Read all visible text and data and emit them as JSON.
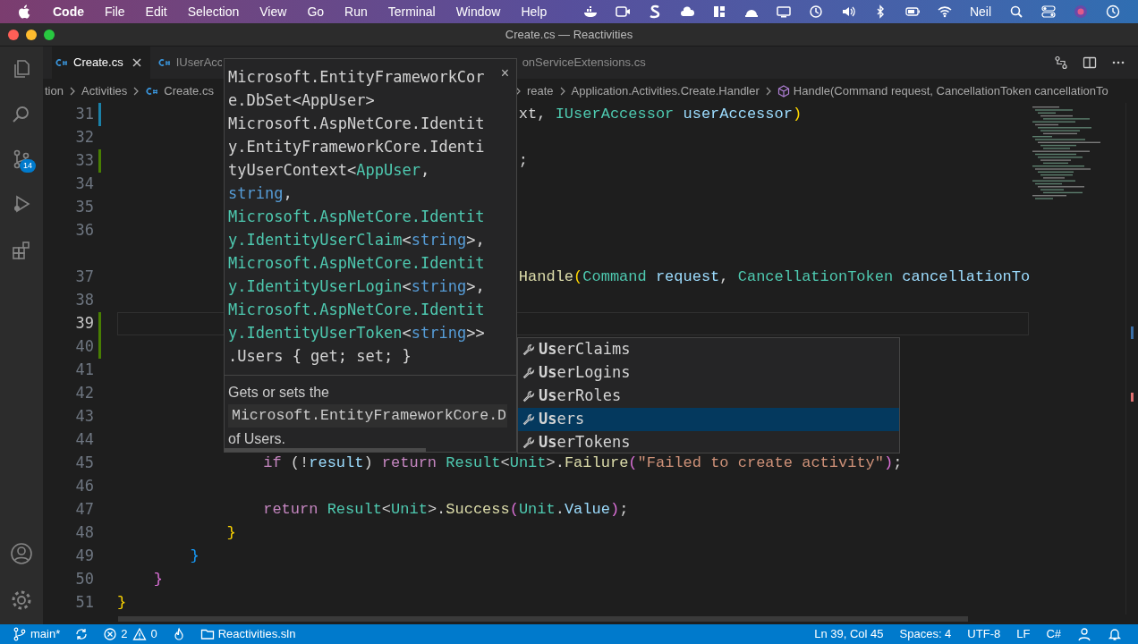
{
  "menu_bar": {
    "app": "Code",
    "items": [
      "File",
      "Edit",
      "Selection",
      "View",
      "Go",
      "Run",
      "Terminal",
      "Window",
      "Help"
    ],
    "user": "Neil"
  },
  "window": {
    "title": "Create.cs — Reactivities"
  },
  "activity_bar": {
    "source_control_badge": "14"
  },
  "tabs": [
    {
      "label": "Create.cs",
      "selected": true,
      "kind": "csharp"
    },
    {
      "label": "IUserAcc",
      "selected": false,
      "kind": "csharp"
    },
    {
      "label": "onServiceExtensions.cs",
      "selected": false,
      "kind": "plain"
    }
  ],
  "breadcrumb": [
    {
      "label": "tion",
      "kind": "plain"
    },
    {
      "label": "Activities",
      "kind": "plain"
    },
    {
      "label": "Create.cs",
      "kind": "csharp"
    },
    {
      "label": "reate",
      "kind": "plain"
    },
    {
      "label": "Application.Activities.Create.Handler",
      "kind": "plain"
    },
    {
      "label": "Handle(Command request, CancellationToken cancellationTo",
      "kind": "method"
    }
  ],
  "editor": {
    "lines": [
      {
        "kind": "code",
        "number": "31",
        "modified": true,
        "added": false,
        "current": false,
        "tokens": [
          {
            "text": "                                            xt, ",
            "kind": "plain"
          },
          {
            "text": "IUserAccessor",
            "kind": "type"
          },
          {
            "text": " userAccessor",
            "kind": "variable"
          },
          {
            "text": ")",
            "kind": "bracket1"
          }
        ]
      },
      {
        "kind": "code",
        "number": "32",
        "modified": false,
        "added": false,
        "current": false
      },
      {
        "kind": "code",
        "number": "33",
        "modified": false,
        "added": true,
        "current": false,
        "tokens": [
          {
            "text": "                                            ;",
            "kind": "plain"
          }
        ]
      },
      {
        "kind": "code",
        "number": "34",
        "modified": false,
        "added": false,
        "current": false
      },
      {
        "kind": "code",
        "number": "35",
        "modified": false,
        "added": false,
        "current": false
      },
      {
        "kind": "code",
        "number": "36",
        "modified": false,
        "added": false,
        "current": false
      },
      {
        "kind": "codelens"
      },
      {
        "kind": "code",
        "number": "37",
        "modified": false,
        "added": false,
        "current": false,
        "tokens": [
          {
            "text": "                                            Handle",
            "kind": "method"
          },
          {
            "text": "(",
            "kind": "bracket1"
          },
          {
            "text": "Command",
            "kind": "type"
          },
          {
            "text": " request",
            "kind": "variable"
          },
          {
            "text": ", ",
            "kind": "plain"
          },
          {
            "text": "CancellationToken",
            "kind": "type"
          },
          {
            "text": " cancellationTo",
            "kind": "variable"
          }
        ]
      },
      {
        "kind": "code",
        "number": "38",
        "modified": false,
        "added": false,
        "current": false
      },
      {
        "kind": "code",
        "number": "39",
        "modified": false,
        "added": true,
        "current": true
      },
      {
        "kind": "code",
        "number": "40",
        "modified": false,
        "added": true,
        "current": false
      },
      {
        "kind": "code",
        "number": "41",
        "modified": false,
        "added": false,
        "current": false
      },
      {
        "kind": "code",
        "number": "42",
        "modified": false,
        "added": false,
        "current": false
      },
      {
        "kind": "code",
        "number": "43",
        "modified": false,
        "added": false,
        "current": false
      },
      {
        "kind": "code",
        "number": "44",
        "modified": false,
        "added": false,
        "current": false
      },
      {
        "kind": "code",
        "number": "45",
        "modified": false,
        "added": false,
        "current": false,
        "tokens": [
          {
            "text": "                if",
            "kind": "keyword"
          },
          {
            "text": " (!",
            "kind": "plain"
          },
          {
            "text": "result",
            "kind": "variable"
          },
          {
            "text": ") ",
            "kind": "plain"
          },
          {
            "text": "return",
            "kind": "keyword"
          },
          {
            "text": " Result",
            "kind": "type"
          },
          {
            "text": "<",
            "kind": "plain"
          },
          {
            "text": "Unit",
            "kind": "type"
          },
          {
            "text": ">.",
            "kind": "plain"
          },
          {
            "text": "Failure",
            "kind": "method"
          },
          {
            "text": "(",
            "kind": "bracket2"
          },
          {
            "text": "\"Failed to create activity\"",
            "kind": "string"
          },
          {
            "text": ")",
            "kind": "bracket2"
          },
          {
            "text": ";",
            "kind": "plain"
          }
        ]
      },
      {
        "kind": "code",
        "number": "46",
        "modified": false,
        "added": false,
        "current": false
      },
      {
        "kind": "code",
        "number": "47",
        "modified": false,
        "added": false,
        "current": false,
        "tokens": [
          {
            "text": "                return",
            "kind": "keyword"
          },
          {
            "text": " Result",
            "kind": "type"
          },
          {
            "text": "<",
            "kind": "plain"
          },
          {
            "text": "Unit",
            "kind": "type"
          },
          {
            "text": ">.",
            "kind": "plain"
          },
          {
            "text": "Success",
            "kind": "method"
          },
          {
            "text": "(",
            "kind": "bracket2"
          },
          {
            "text": "Unit",
            "kind": "type"
          },
          {
            "text": ".",
            "kind": "plain"
          },
          {
            "text": "Value",
            "kind": "variable"
          },
          {
            "text": ")",
            "kind": "bracket2"
          },
          {
            "text": ";",
            "kind": "plain"
          }
        ]
      },
      {
        "kind": "code",
        "number": "48",
        "modified": false,
        "added": false,
        "current": false,
        "tokens": [
          {
            "text": "            }",
            "kind": "bracket1"
          }
        ]
      },
      {
        "kind": "code",
        "number": "49",
        "modified": false,
        "added": false,
        "current": false,
        "tokens": [
          {
            "text": "        }",
            "kind": "bracket3"
          }
        ]
      },
      {
        "kind": "code",
        "number": "50",
        "modified": false,
        "added": false,
        "current": false,
        "tokens": [
          {
            "text": "    }",
            "kind": "bracket2"
          }
        ]
      },
      {
        "kind": "code",
        "number": "51",
        "modified": false,
        "added": false,
        "current": false,
        "tokens": [
          {
            "text": "}",
            "kind": "bracket1"
          }
        ]
      }
    ]
  },
  "hover": {
    "signature": [
      {
        "text": "Microsoft.EntityFrameworkCore.DbSet<AppUser> ",
        "kind": "plain"
      },
      {
        "text": "Microsoft.AspNetCore.Identity.EntityFrameworkCore.IdentityUserContext<",
        "kind": "plain"
      },
      {
        "text": "AppUser",
        "kind": "type"
      },
      {
        "text": ", ",
        "kind": "plain"
      },
      {
        "text": "string",
        "kind": "builtin"
      },
      {
        "text": ", ",
        "kind": "plain"
      },
      {
        "text": "Microsoft.AspNetCore.Identity.IdentityUserClaim",
        "kind": "type"
      },
      {
        "text": "<",
        "kind": "plain"
      },
      {
        "text": "string",
        "kind": "builtin"
      },
      {
        "text": ">, ",
        "kind": "plain"
      },
      {
        "text": "Microsoft.AspNetCore.Identity.IdentityUserLogin",
        "kind": "type"
      },
      {
        "text": "<",
        "kind": "plain"
      },
      {
        "text": "string",
        "kind": "builtin"
      },
      {
        "text": ">, ",
        "kind": "plain"
      },
      {
        "text": "Microsoft.AspNetCore.Identity.IdentityUserToken",
        "kind": "type"
      },
      {
        "text": "<",
        "kind": "plain"
      },
      {
        "text": "string",
        "kind": "builtin"
      },
      {
        "text": ">>",
        "kind": "plain"
      },
      {
        "text": ".Users { get; set; }",
        "kind": "plain"
      }
    ],
    "close": "×",
    "doc": [
      {
        "text": "Gets or sets the",
        "kind": "text"
      },
      {
        "text": "Microsoft.EntityFrameworkCore.D",
        "kind": "code"
      },
      {
        "text": "of Users.",
        "kind": "text"
      }
    ]
  },
  "suggestions": [
    {
      "label": "**Us**erClaims",
      "selected": false
    },
    {
      "label": "**Us**erLogins",
      "selected": false
    },
    {
      "label": "**Us**erRoles",
      "selected": false
    },
    {
      "label": "**Us**ers",
      "selected": true
    },
    {
      "label": "**Us**erTokens",
      "selected": false
    }
  ],
  "status_bar": {
    "left": [
      {
        "kind": "branch",
        "text": "main*"
      },
      {
        "kind": "sync"
      },
      {
        "kind": "error",
        "text": "2"
      },
      {
        "kind": "warning",
        "text": "0"
      },
      {
        "kind": "flame"
      },
      {
        "kind": "folder",
        "text": "Reactivities.sln"
      }
    ],
    "right": [
      {
        "text": "Ln 39, Col 45"
      },
      {
        "text": "Spaces: 4"
      },
      {
        "text": "UTF-8"
      },
      {
        "text": "LF"
      },
      {
        "text": "C#"
      }
    ]
  }
}
